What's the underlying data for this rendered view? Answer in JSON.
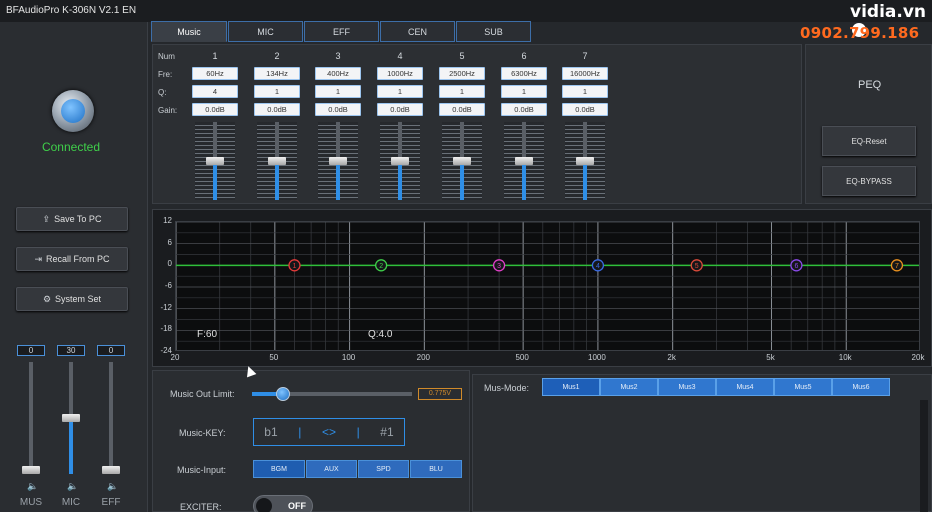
{
  "window": {
    "title": "BFAudioPro K-306N V2.1 EN"
  },
  "watermark": {
    "logo": "vidia.vn",
    "phone": "0902.799.186"
  },
  "status": {
    "connection": "Connected"
  },
  "left_buttons": [
    {
      "label": "Save To PC",
      "icon": "upload-icon"
    },
    {
      "label": "Recall From PC",
      "icon": "import-icon"
    },
    {
      "label": "System Set",
      "icon": "gear-icon"
    }
  ],
  "volumes": [
    {
      "label": "MUS",
      "value": "0",
      "level": 0.0
    },
    {
      "label": "MIC",
      "value": "30",
      "level": 0.5
    },
    {
      "label": "EFF",
      "value": "0",
      "level": 0.0
    }
  ],
  "tabs": [
    {
      "label": "Music",
      "active": true
    },
    {
      "label": "MIC",
      "active": false
    },
    {
      "label": "EFF",
      "active": false
    },
    {
      "label": "CEN",
      "active": false
    },
    {
      "label": "SUB",
      "active": false
    }
  ],
  "eq": {
    "row_labels": {
      "num": "Num",
      "freq": "Fre:",
      "q": "Q:",
      "gain": "Gain:"
    },
    "bands": [
      {
        "num": "1",
        "freq": "60Hz",
        "q": "4",
        "gain": "0.0dB",
        "level": 0.5
      },
      {
        "num": "2",
        "freq": "134Hz",
        "q": "1",
        "gain": "0.0dB",
        "level": 0.5
      },
      {
        "num": "3",
        "freq": "400Hz",
        "q": "1",
        "gain": "0.0dB",
        "level": 0.5
      },
      {
        "num": "4",
        "freq": "1000Hz",
        "q": "1",
        "gain": "0.0dB",
        "level": 0.5
      },
      {
        "num": "5",
        "freq": "2500Hz",
        "q": "1",
        "gain": "0.0dB",
        "level": 0.5
      },
      {
        "num": "6",
        "freq": "6300Hz",
        "q": "1",
        "gain": "0.0dB",
        "level": 0.5
      },
      {
        "num": "7",
        "freq": "16000Hz",
        "q": "1",
        "gain": "0.0dB",
        "level": 0.5
      }
    ]
  },
  "peq": {
    "title": "PEQ",
    "reset_label": "EQ-Reset",
    "bypass_label": "EQ-BYPASS"
  },
  "graph": {
    "info_freq": "F:60",
    "info_q": "Q:4.0",
    "y_ticks": [
      "12",
      "6",
      "0",
      "-6",
      "-12",
      "-18",
      "-24"
    ],
    "x_ticks": [
      "20",
      "50",
      "100",
      "200",
      "500",
      "1000",
      "2k",
      "5k",
      "10k",
      "20k"
    ],
    "x_tick_values": [
      20,
      50,
      100,
      200,
      500,
      1000,
      2000,
      5000,
      10000,
      20000
    ],
    "ylim": [
      -24,
      12
    ],
    "xlim": [
      20,
      20000
    ],
    "curve_color": "#2fbf3a",
    "points": [
      {
        "label": "1",
        "freq": 60,
        "gain": 0,
        "color": "#e23a3a"
      },
      {
        "label": "2",
        "freq": 134,
        "gain": 0,
        "color": "#3fcf4a"
      },
      {
        "label": "3",
        "freq": 400,
        "gain": 0,
        "color": "#e040c8"
      },
      {
        "label": "4",
        "freq": 1000,
        "gain": 0,
        "color": "#3a6ae2"
      },
      {
        "label": "5",
        "freq": 2500,
        "gain": 0,
        "color": "#d94a3a"
      },
      {
        "label": "6",
        "freq": 6300,
        "gain": 0,
        "color": "#8a4ae8"
      },
      {
        "label": "7",
        "freq": 16000,
        "gain": 0,
        "color": "#e8901f"
      }
    ]
  },
  "music_out": {
    "label": "Music Out Limit:",
    "value": "0.775V",
    "level": 0.19
  },
  "music_key": {
    "label": "Music-KEY:",
    "flat": "b1",
    "center": "<>",
    "sharp": "#1"
  },
  "music_input": {
    "label": "Music-Input:",
    "options": [
      "BGM",
      "AUX",
      "SPD",
      "BLU"
    ],
    "selected": "BGM"
  },
  "exciter": {
    "label": "EXCITER:",
    "state": "OFF"
  },
  "mus_mode": {
    "label": "Mus-Mode:",
    "options": [
      "Mus1",
      "Mus2",
      "Mus3",
      "Mus4",
      "Mus5",
      "Mus6"
    ],
    "selected": "Mus1"
  }
}
